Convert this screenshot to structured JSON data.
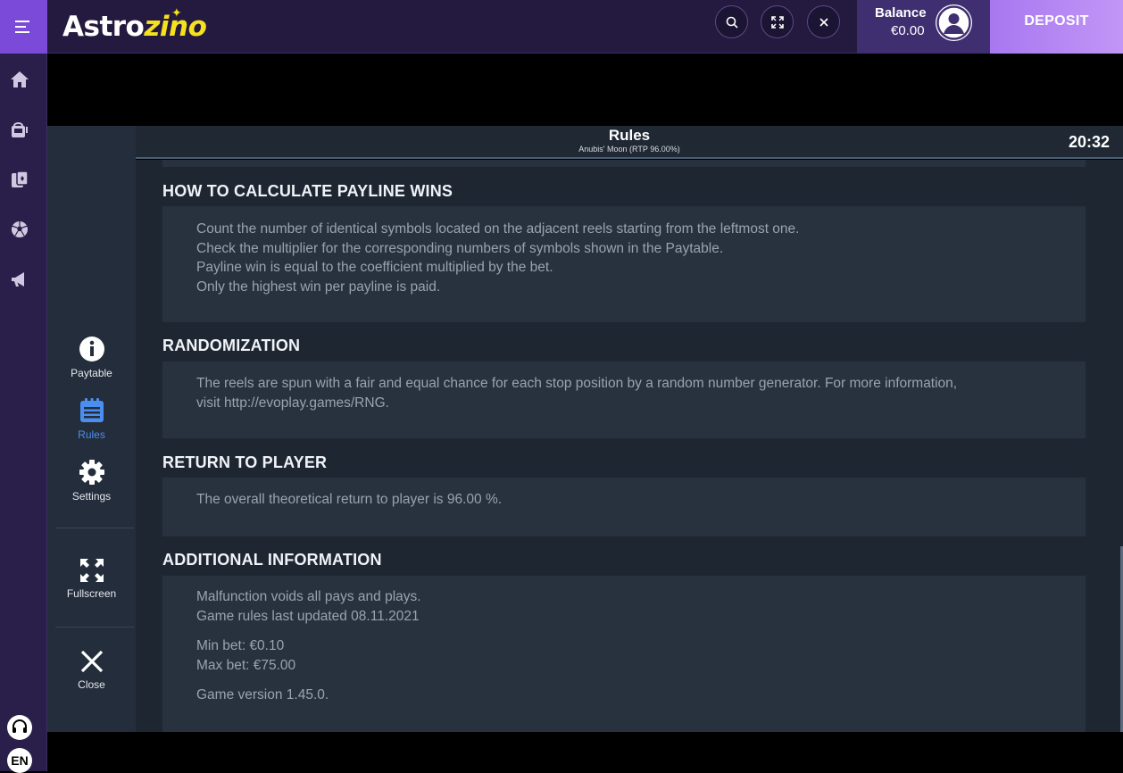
{
  "header": {
    "logo_white": "Astro",
    "logo_yellow": "zino",
    "balance_label": "Balance",
    "balance_value": "€0.00",
    "deposit_label": "DEPOSIT"
  },
  "sidebar": {
    "language": "EN"
  },
  "game_nav": {
    "paytable": "Paytable",
    "rules": "Rules",
    "settings": "Settings",
    "fullscreen": "Fullscreen",
    "close": "Close"
  },
  "rules": {
    "title": "Rules",
    "subtitle": "Anubis' Moon (RTP 96.00%)",
    "clock": "20:32"
  },
  "sections": {
    "payline": {
      "title": "HOW TO CALCULATE PAYLINE WINS",
      "lines": [
        "Count the number of identical symbols located on the adjacent reels starting from the leftmost one.",
        "Check the multiplier for the corresponding numbers of symbols shown in the Paytable.",
        "Payline win is equal to the coefficient multiplied by the bet.",
        "Only the highest win per payline is paid."
      ]
    },
    "randomization": {
      "title": "RANDOMIZATION",
      "lines": [
        "The reels are spun with a fair and equal chance for each stop position by a random number generator. For more information,",
        "visit http://evoplay.games/RNG."
      ]
    },
    "rtp": {
      "title": "RETURN TO PLAYER",
      "lines": [
        "The overall theoretical return to player is 96.00 %."
      ]
    },
    "additional": {
      "title": "ADDITIONAL INFORMATION",
      "lines": [
        "Malfunction voids all pays and plays.",
        "Game rules last updated 08.11.2021",
        "Min bet: €0.10",
        "Max bet: €75.00",
        "Game version 1.45.0."
      ]
    }
  },
  "colors": {
    "brand_purple": "#7b4ad8",
    "header_bg": "#241a3f",
    "logo_yellow": "#f6e11f",
    "deposit_gradient_start": "#a778f0",
    "active_nav_blue": "#4a8ff0",
    "panel_bg": "#28323f"
  }
}
